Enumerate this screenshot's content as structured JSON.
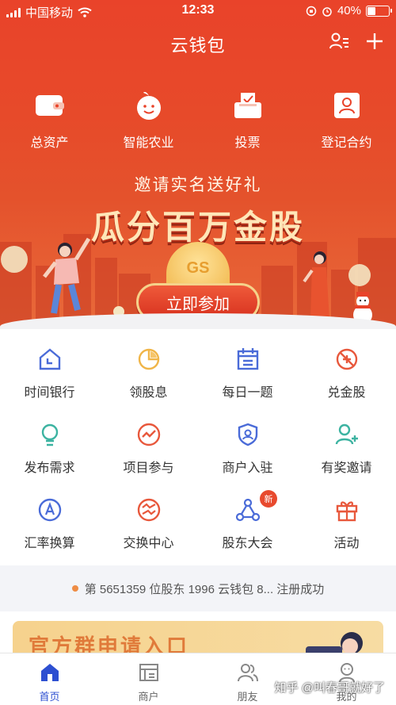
{
  "status_bar": {
    "carrier": "中国移动",
    "time": "12:33",
    "battery": "40%",
    "battery_level": 0.4
  },
  "header": {
    "title": "云钱包"
  },
  "quick_actions": [
    {
      "label": "总资产",
      "icon": "wallet-icon"
    },
    {
      "label": "智能农业",
      "icon": "orange-mascot-icon"
    },
    {
      "label": "投票",
      "icon": "ballot-box-icon"
    },
    {
      "label": "登记合约",
      "icon": "contract-icon"
    }
  ],
  "banner": {
    "subtitle": "邀请实名送好礼",
    "title": "瓜分百万金股",
    "coin_text": "GS",
    "button_label": "立即参加"
  },
  "grid": [
    {
      "label": "时间银行",
      "icon": "house-icon",
      "color": "#4a6bd8"
    },
    {
      "label": "领股息",
      "icon": "pie-chart-icon",
      "color": "#f0b548"
    },
    {
      "label": "每日一题",
      "icon": "calendar-icon",
      "color": "#4a6bd8"
    },
    {
      "label": "兑金股",
      "icon": "coupon-icon",
      "color": "#e8583c"
    },
    {
      "label": "发布需求",
      "icon": "lightbulb-icon",
      "color": "#3cb3a1"
    },
    {
      "label": "项目参与",
      "icon": "trend-icon",
      "color": "#e8583c"
    },
    {
      "label": "商户入驻",
      "icon": "shield-user-icon",
      "color": "#4a6bd8"
    },
    {
      "label": "有奖邀请",
      "icon": "add-user-icon",
      "color": "#3cb3a1"
    },
    {
      "label": "汇率换算",
      "icon": "exchange-a-icon",
      "color": "#4a6bd8"
    },
    {
      "label": "交换中心",
      "icon": "swap-icon",
      "color": "#e8583c"
    },
    {
      "label": "股东大会",
      "icon": "network-icon",
      "color": "#4a6bd8",
      "badge": "新"
    },
    {
      "label": "活动",
      "icon": "gift-icon",
      "color": "#e8583c"
    }
  ],
  "notice": {
    "text": "第 5651359 位股东 1996 云钱包 8... 注册成功"
  },
  "card": {
    "title": "官方群申请入口"
  },
  "tabbar": [
    {
      "label": "首页",
      "icon": "home-icon",
      "active": true
    },
    {
      "label": "商户",
      "icon": "store-icon",
      "active": false
    },
    {
      "label": "朋友",
      "icon": "friends-icon",
      "active": false
    },
    {
      "label": "我的",
      "icon": "profile-icon",
      "active": false
    }
  ],
  "watermark": "知乎 @叫春哥就好了",
  "colors": {
    "primary": "#e9432a",
    "accent_blue": "#2d4fd1",
    "gold": "#f5d28a"
  }
}
